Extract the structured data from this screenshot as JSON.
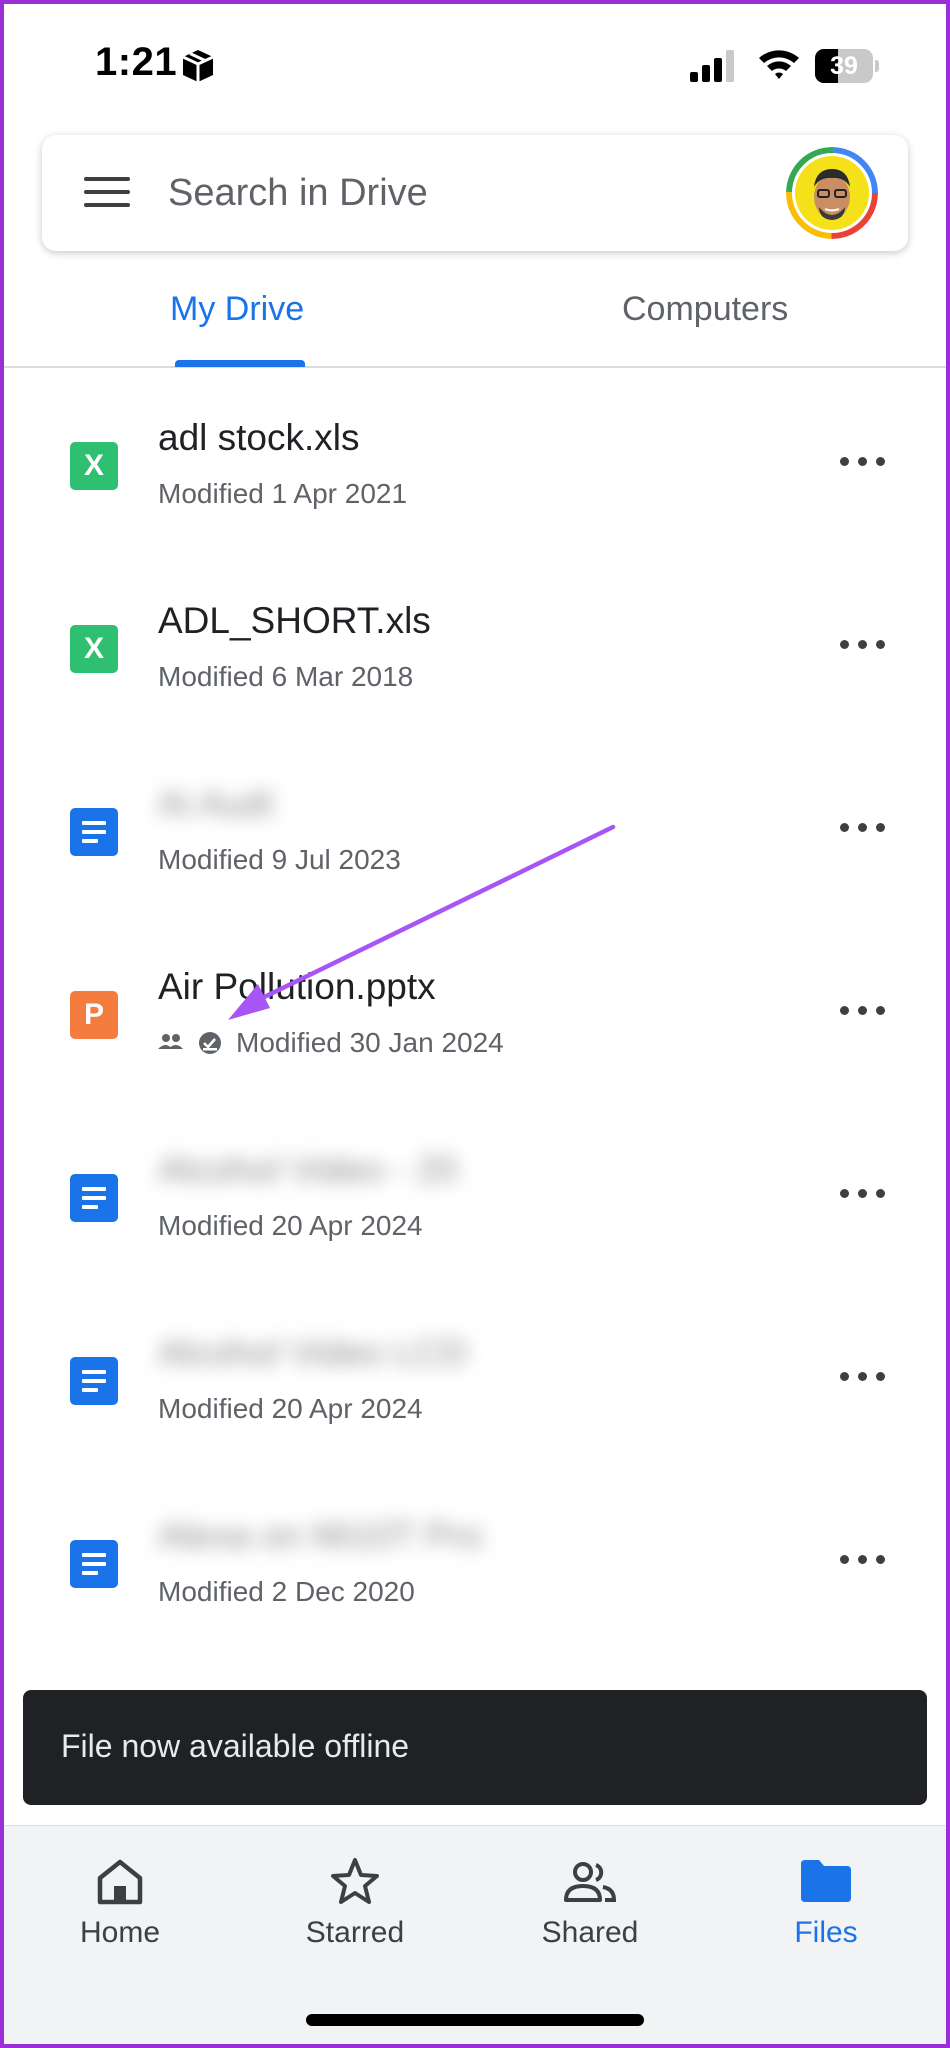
{
  "status_bar": {
    "time": "1:21",
    "battery": "39",
    "battery_level": 0.39,
    "icons": [
      "cube-icon",
      "signal-icon",
      "wifi-icon",
      "battery-icon"
    ]
  },
  "search": {
    "placeholder": "Search in Drive",
    "menu_icon": "menu-icon",
    "avatar_icon": "avatar"
  },
  "tabs": [
    {
      "label": "My Drive",
      "active": true
    },
    {
      "label": "Computers",
      "active": false
    }
  ],
  "files": [
    {
      "name": "adl stock.xls",
      "modified": "Modified 1 Apr 2021",
      "type": "xls",
      "icon_letter": "X",
      "blurred": false
    },
    {
      "name": "ADL_SHORT.xls",
      "modified": "Modified 6 Mar 2018",
      "type": "xls",
      "icon_letter": "X",
      "blurred": false
    },
    {
      "name": "Ai Audi",
      "modified": "Modified 9 Jul 2023",
      "type": "doc",
      "blurred": true
    },
    {
      "name": "Air Pollution.pptx",
      "modified": "Modified 30 Jan 2024",
      "type": "ppt",
      "icon_letter": "P",
      "blurred": false,
      "shared": true,
      "offline": true
    },
    {
      "name": "Alcohol Video - 20",
      "modified": "Modified 20 Apr 2024",
      "type": "doc",
      "blurred": true
    },
    {
      "name": "Alcohol Video LCD",
      "modified": "Modified 20 Apr 2024",
      "type": "doc",
      "blurred": true
    },
    {
      "name": "Alexa on Mi10T Pro",
      "modified": "Modified 2 Dec 2020",
      "type": "doc",
      "blurred": true
    }
  ],
  "snackbar": {
    "text": "File now available offline"
  },
  "bottom_nav": [
    {
      "label": "Home",
      "icon": "home-icon",
      "active": false
    },
    {
      "label": "Starred",
      "icon": "star-icon",
      "active": false
    },
    {
      "label": "Shared",
      "icon": "shared-icon",
      "active": false
    },
    {
      "label": "Files",
      "icon": "folder-icon",
      "active": true
    }
  ],
  "colors": {
    "accent": "#1a73e8",
    "xls": "#2fbf71",
    "ppt": "#f57c3f",
    "doc": "#1a73e8",
    "annotation": "#a855f7",
    "frame": "#9b2fd6"
  }
}
